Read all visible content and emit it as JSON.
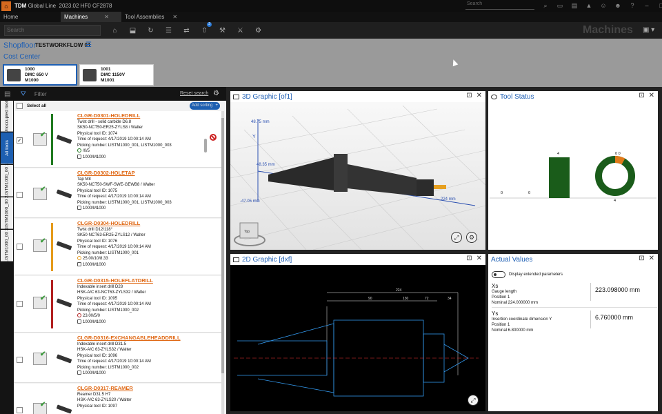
{
  "app": {
    "name": "TDM",
    "product": "Global Line",
    "version": "2023.02 HF0 CF2878",
    "search_placeholder": "Search"
  },
  "tabs": [
    {
      "label": "Home"
    },
    {
      "label": "Machines"
    },
    {
      "label": "Tool Assemblies"
    }
  ],
  "toolbar": {
    "search_placeholder": "Search",
    "badge_count": "3"
  },
  "page_title": "Machines",
  "shopfloor": {
    "label": "Shopfloor",
    "workflow": "TESTWORKFLOW 01",
    "cost_center_label": "Cost Center"
  },
  "machines": [
    {
      "id": "1000",
      "name": "DMC 650 V",
      "code": "M1000"
    },
    {
      "id": "1001",
      "name": "DMC 1150V",
      "code": "M1001"
    }
  ],
  "left_panel": {
    "filter_placeholder": "Filter",
    "reset_search": "Reset search",
    "select_all": "Select all",
    "add_sorting": "Add sorting",
    "vtabs": [
      "Unoccupied tools",
      "All tools",
      "LISTM1000_00 1",
      "LISTM1000_00 2",
      "LISTM1000_00 3"
    ]
  },
  "tools": [
    {
      "name": "CLGR-D0301-HOLEDRILL",
      "desc": "Twist drill - solid carbide D6.8",
      "adapter": "SK50-NCT50-ER25-ZYLS8 / Walter",
      "physical_id": "Physical tool ID: 1074",
      "time": "Time of request: 4/17/2019 10:00:14 AM",
      "picking": "Picking number: LISTM1000_001, LISTM1000_003",
      "life": "/0/5",
      "machine": "1000/M1000",
      "color": "#1f7a1f",
      "checked": true
    },
    {
      "name": "CLGR-D0302-HOLETAP",
      "desc": "Tap M8",
      "adapter": "SK50-NCT50-SWF-SWE-GEWB8 / Walter",
      "physical_id": "Physical tool ID: 1075",
      "time": "Time of request: 4/17/2019 10:00:14 AM",
      "picking": "Picking number: LISTM1000_001, LISTM1000_003",
      "life": "",
      "machine": "1000/M1000",
      "color": "",
      "checked": false
    },
    {
      "name": "CLGR-D0304-HOLEDRILL",
      "desc": "Twist drill D12/118°",
      "adapter": "SK50-NCT63-ER25-ZYLS12 / Walter",
      "physical_id": "Physical tool ID: 1076",
      "time": "Time of request: 4/17/2019 10:00:14 AM",
      "picking": "Picking number: LISTM1000_001",
      "life": "25.00/10/8.33",
      "machine": "1000/M1000",
      "color": "#e59a1a",
      "checked": false
    },
    {
      "name": "CLGR-D0315-HOLEFLATDRILL",
      "desc": "Indexable insert drill D28",
      "adapter": "HSK-A/C 63-NCT63-ZYLS32 / Walter",
      "physical_id": "Physical tool ID: 1095",
      "time": "Time of request: 4/17/2019 10:00:14 AM",
      "picking": "Picking number: LISTM1000_002",
      "life": "23.00/5/0",
      "machine": "1000/M1000",
      "color": "#b21f1f",
      "checked": false
    },
    {
      "name": "CLGR-D0316-EXCHANGABLEHEADDRILL",
      "desc": "Indexable insert drill D31.5",
      "adapter": "HSK-A/C 63-ZYLS32 / Walter",
      "physical_id": "Physical tool ID: 1096",
      "time": "Time of request: 4/17/2019 10:00:14 AM",
      "picking": "Picking number: LISTM1000_002",
      "life": "",
      "machine": "1000/M1000",
      "color": "",
      "checked": false
    },
    {
      "name": "CLGR-D0317-REAMER",
      "desc": "Reamer D31.5 H7",
      "adapter": "HSK-A/C 63-ZYLS20 / Walter",
      "physical_id": "Physical tool ID: 1097",
      "time": "",
      "picking": "",
      "life": "",
      "machine": "",
      "color": "",
      "checked": false
    }
  ],
  "graphic3d": {
    "title": "3D Graphic [of1]",
    "label_y": "48.75 mm",
    "label_x": "224 mm",
    "label_left": "-47.05 mm",
    "label_mid": "48.35 mm",
    "cube": "Top"
  },
  "tool_status": {
    "title": "Tool Status",
    "bars": [
      {
        "label": "0"
      },
      {
        "label": "0"
      },
      {
        "label": "4",
        "value": 4
      }
    ],
    "donut_top": "0 0",
    "donut_bottom": "4",
    "green": "#1a5c1a",
    "accent": "#e07a1a"
  },
  "graphic2d": {
    "title": "2D Graphic [dxf]",
    "dims": [
      "224",
      "90",
      "130",
      "72",
      "34"
    ]
  },
  "actual_values": {
    "title": "Actual Values",
    "toggle_label": "Display extended parameters",
    "blocks": [
      {
        "key": "Xs",
        "desc": "Gauge length",
        "pos": "Position 1",
        "nominal": "Nominal   224.000000 mm",
        "value": "223.098000 mm"
      },
      {
        "key": "Ys",
        "desc": "Insertion coordinate dimension Y",
        "pos": "Position 1",
        "nominal": "Nominal   6.800000 mm",
        "value": "6.760000 mm"
      }
    ]
  }
}
